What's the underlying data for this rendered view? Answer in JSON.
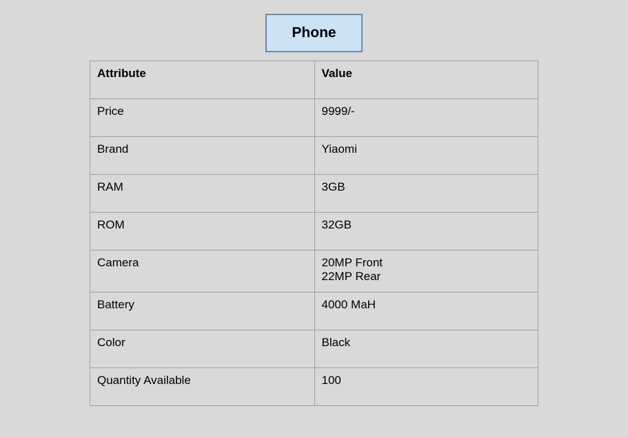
{
  "title": "Phone",
  "table": {
    "headers": {
      "attribute": "Attribute",
      "value": "Value"
    },
    "rows": [
      {
        "attribute": "Price",
        "value": "9999/-"
      },
      {
        "attribute": "Brand",
        "value": "Yiaomi"
      },
      {
        "attribute": "RAM",
        "value": "3GB"
      },
      {
        "attribute": "ROM",
        "value": "32GB"
      },
      {
        "attribute": "Camera",
        "value": "20MP Front\n22MP Rear"
      },
      {
        "attribute": "Battery",
        "value": "4000 MaH"
      },
      {
        "attribute": "Color",
        "value": "Black"
      },
      {
        "attribute": "Quantity Available",
        "value": "100"
      }
    ]
  }
}
